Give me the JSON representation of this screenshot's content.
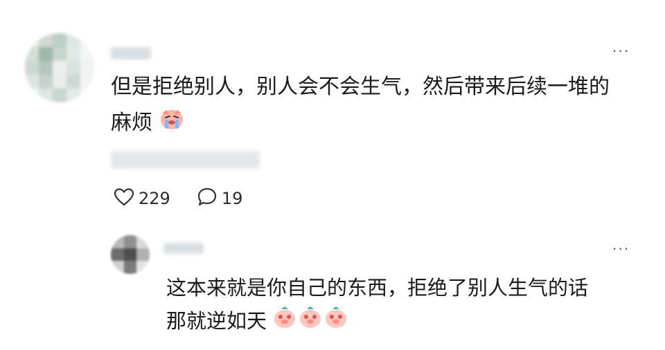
{
  "comment": {
    "more_label": "···",
    "text_line1": "但是拒绝别人，别人会不会生气，然后带来后续一堆的",
    "text_line2": "麻烦",
    "emoji": "cry-emoji",
    "likes": "229",
    "replies": "19"
  },
  "reply": {
    "more_label": "···",
    "text_line1": "这本来就是你自己的东西，拒绝了别人生气的话",
    "text_line2": "那就逆如天",
    "emoji": "shy-pig-emoji"
  },
  "colors": {
    "text": "#1a1a1a",
    "muted": "#555555",
    "blur": "#d9dee2"
  }
}
